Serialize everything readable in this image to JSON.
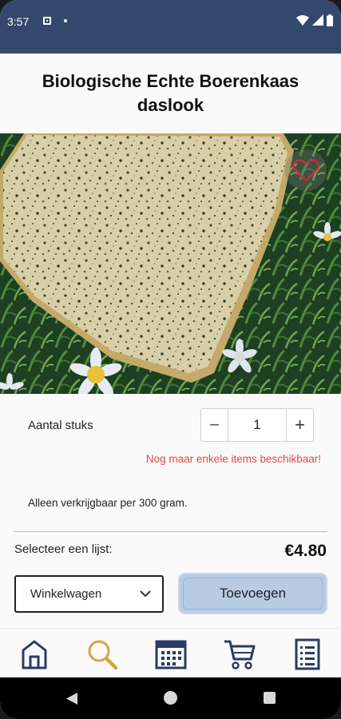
{
  "status_bar": {
    "time": "3:57"
  },
  "product": {
    "title": "Biologische Echte Boerenkaas daslook",
    "image_icon": "cheese-photo"
  },
  "quantity": {
    "label": "Aantal stuks",
    "value": "1",
    "minus": "−",
    "plus": "+",
    "warning": "Nog maar enkele items beschikbaar!"
  },
  "availability_note": "Alleen verkrijgbaar per 300 gram.",
  "purchase": {
    "select_list_label": "Selecteer een lijst:",
    "price": "€4.80",
    "list_selected": "Winkelwagen",
    "add_label": "Toevoegen"
  },
  "bottom_nav": {
    "items": [
      "home-icon",
      "search-icon",
      "calendar-icon",
      "cart-icon",
      "list-icon"
    ]
  },
  "colors": {
    "header": "#33486c",
    "nav_icon": "#2a3c63",
    "search_accent": "#d7a346",
    "warning": "#e0494a",
    "favorite": "#c0303a",
    "button": "#b7cce3"
  }
}
